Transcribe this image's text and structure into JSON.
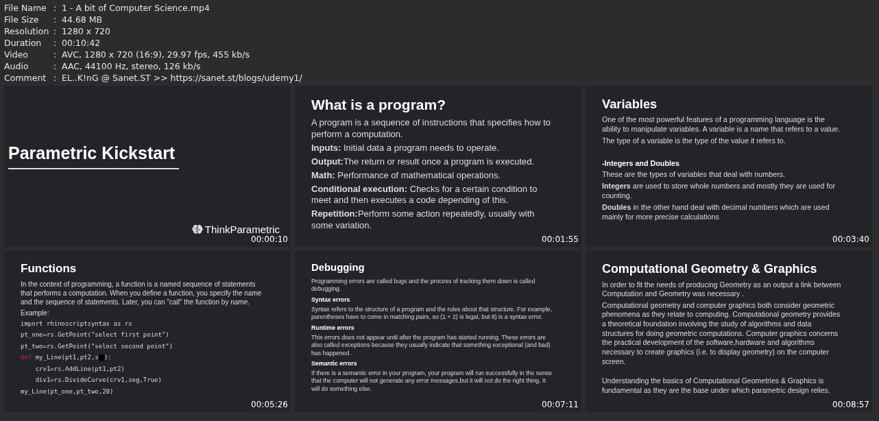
{
  "file_info": [
    {
      "label": "File Name",
      "value": "1 - A bit of Computer Science.mp4"
    },
    {
      "label": "File Size",
      "value": "44.68 MB"
    },
    {
      "label": "Resolution",
      "value": "1280 x 720"
    },
    {
      "label": "Duration",
      "value": "00:10:42"
    },
    {
      "label": "Video",
      "value": "AVC, 1280 x 720 (16:9), 29.97 fps, 455 kb/s"
    },
    {
      "label": "Audio",
      "value": "AAC, 44100 Hz, stereo, 126 kb/s"
    },
    {
      "label": "Comment",
      "value": "EL..K!nG @ Sanet.ST >> https://sanet.st/blogs/udemy1/"
    }
  ],
  "separator": ":",
  "thumbnails": [
    {
      "kind": "title",
      "title": "Parametric Kickstart",
      "logo": "ThinkParametric",
      "timestamp": "00:00:10"
    },
    {
      "kind": "slide",
      "title": "What is a program?",
      "timestamp": "00:01:55",
      "blocks": [
        {
          "kind": "para",
          "text": "A program is a sequence of instructions that specifies how to perform a computation."
        },
        {
          "kind": "para",
          "text": "**Inputs:** Initial data a program needs to operate."
        },
        {
          "kind": "para",
          "text": "**Output:**The return or result once a program is executed."
        },
        {
          "kind": "para",
          "text": "**Math:** Performance of mathematical operations."
        },
        {
          "kind": "para",
          "text": "**Conditional execution:** Checks for a certain condition to meet and then executes a code depending of this."
        },
        {
          "kind": "para",
          "text": "**Repetition:**Perform some action repeatedly, usually with some variation."
        }
      ]
    },
    {
      "kind": "slide",
      "title": "Variables",
      "timestamp": "00:03:40",
      "blocks": [
        {
          "kind": "para",
          "text": "One of the most powerful features of a programming language is the ability to manipulate variables. A variable is a name that refers to a value."
        },
        {
          "kind": "para",
          "text": "The type of a variable is the type of the value it refers to."
        },
        {
          "kind": "gap"
        },
        {
          "kind": "heading",
          "text": "-Integers and Doubles"
        },
        {
          "kind": "para",
          "text": "These  are  the types of variables that deal with numbers."
        },
        {
          "kind": "para",
          "text": "**Integers** are used to store whole numbers and mostly they are used for counting."
        },
        {
          "kind": "para",
          "text": "**Doubles** in the other hand deal with decimal numbers which are used mainly for more precise calculations"
        }
      ]
    },
    {
      "kind": "slide",
      "title": "Functions",
      "timestamp": "00:05:26",
      "blocks": [
        {
          "kind": "para",
          "text": "In the context of programming, a function is a named sequence of statements that performs a computation. When you define a function, you specify the name and the sequence of statements. Later, you can \"call\" the function by name."
        },
        {
          "kind": "para",
          "text": "Example:"
        },
        {
          "kind": "code",
          "text": "import rhinoscriptsyntax as rs"
        },
        {
          "kind": "code",
          "text": "pt_one=rs.GetPoint(\"select first point\")"
        },
        {
          "kind": "code",
          "text": "pt_two=rs.GetPoint(\"select second point\")"
        },
        {
          "kind": "code",
          "keyword": "def",
          "text": " my_Line(pt1,pt2,s",
          "blot": true,
          "after": "):"
        },
        {
          "kind": "code",
          "text": "    crv1=rs.AddLine(pt1,pt2)"
        },
        {
          "kind": "code",
          "text": "    div1=rs.DivideCurve(crv1,seg,True)"
        },
        {
          "kind": "code",
          "text": "my_Line(pt_one,pt_two,20)"
        }
      ]
    },
    {
      "kind": "slide",
      "title": "Debugging",
      "timestamp": "00:07:11",
      "blocks": [
        {
          "kind": "para",
          "text": "Programming errors are called bugs and the process of tracking them down is called debugging."
        },
        {
          "kind": "heading",
          "text": "Syntax errors"
        },
        {
          "kind": "para",
          "text": "Syntax refers to the structure of a program and the rules about that structure. For example, parentheses have to come in matching pairs, so (1 + 2) is legal, but 8) is a syntax error."
        },
        {
          "kind": "heading",
          "text": "Runtime errors"
        },
        {
          "kind": "para",
          "text": "This errors does not appear until after the program has started running. These errors are also called exceptions because they usually indicate that something exceptional (and bad) has happened ."
        },
        {
          "kind": "heading",
          "text": "Semantic errors"
        },
        {
          "kind": "para",
          "text": "If there is a semantic error in your program, your program  will run successfully in the sense that the computer will not generate any error messages,but it will not do the right thing. It will do something else."
        }
      ]
    },
    {
      "kind": "slide",
      "title": "Computational Geometry & Graphics",
      "timestamp": "00:08:57",
      "blocks": [
        {
          "kind": "para",
          "text": "In order to fit the needs of producing Geometry as an output a link between Computation and Geometry  was necessary ."
        },
        {
          "kind": "para",
          "text": "Computational geometry and computer graphics both consider geometric phenomena as they relate to computing. Computational geometry provides a theoretical foundation involving the study of algorithms and data structures for doing geometric computations. Computer graphics concerns the practical development of the software,hardware and algorithms necessary to create graphics (i.e. to display geometry) on the computer screen."
        },
        {
          "kind": "gap"
        },
        {
          "kind": "para",
          "text": "Understanding the basics of Computational Geometries & Graphics is fundamental as they are the base under which parametric design relies."
        }
      ]
    }
  ]
}
